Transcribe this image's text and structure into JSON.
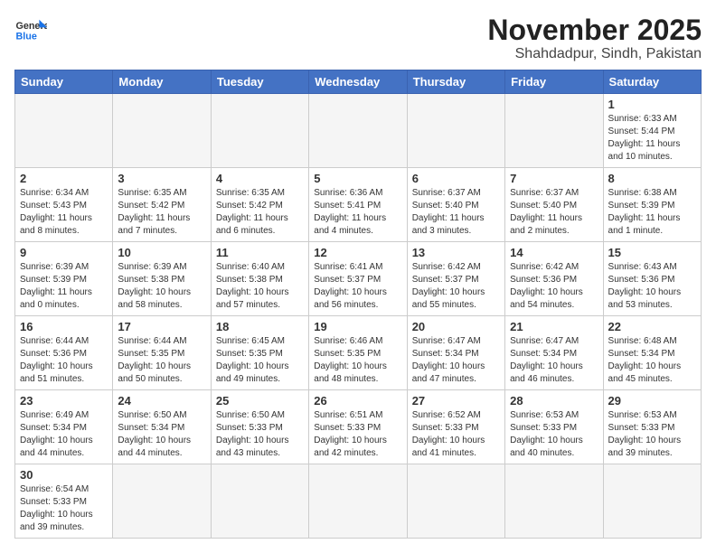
{
  "logo": {
    "text_general": "General",
    "text_blue": "Blue"
  },
  "title": "November 2025",
  "subtitle": "Shahdadpur, Sindh, Pakistan",
  "days_of_week": [
    "Sunday",
    "Monday",
    "Tuesday",
    "Wednesday",
    "Thursday",
    "Friday",
    "Saturday"
  ],
  "weeks": [
    [
      {
        "day": "",
        "info": ""
      },
      {
        "day": "",
        "info": ""
      },
      {
        "day": "",
        "info": ""
      },
      {
        "day": "",
        "info": ""
      },
      {
        "day": "",
        "info": ""
      },
      {
        "day": "",
        "info": ""
      },
      {
        "day": "1",
        "info": "Sunrise: 6:33 AM\nSunset: 5:44 PM\nDaylight: 11 hours and 10 minutes."
      }
    ],
    [
      {
        "day": "2",
        "info": "Sunrise: 6:34 AM\nSunset: 5:43 PM\nDaylight: 11 hours and 8 minutes."
      },
      {
        "day": "3",
        "info": "Sunrise: 6:35 AM\nSunset: 5:42 PM\nDaylight: 11 hours and 7 minutes."
      },
      {
        "day": "4",
        "info": "Sunrise: 6:35 AM\nSunset: 5:42 PM\nDaylight: 11 hours and 6 minutes."
      },
      {
        "day": "5",
        "info": "Sunrise: 6:36 AM\nSunset: 5:41 PM\nDaylight: 11 hours and 4 minutes."
      },
      {
        "day": "6",
        "info": "Sunrise: 6:37 AM\nSunset: 5:40 PM\nDaylight: 11 hours and 3 minutes."
      },
      {
        "day": "7",
        "info": "Sunrise: 6:37 AM\nSunset: 5:40 PM\nDaylight: 11 hours and 2 minutes."
      },
      {
        "day": "8",
        "info": "Sunrise: 6:38 AM\nSunset: 5:39 PM\nDaylight: 11 hours and 1 minute."
      }
    ],
    [
      {
        "day": "9",
        "info": "Sunrise: 6:39 AM\nSunset: 5:39 PM\nDaylight: 11 hours and 0 minutes."
      },
      {
        "day": "10",
        "info": "Sunrise: 6:39 AM\nSunset: 5:38 PM\nDaylight: 10 hours and 58 minutes."
      },
      {
        "day": "11",
        "info": "Sunrise: 6:40 AM\nSunset: 5:38 PM\nDaylight: 10 hours and 57 minutes."
      },
      {
        "day": "12",
        "info": "Sunrise: 6:41 AM\nSunset: 5:37 PM\nDaylight: 10 hours and 56 minutes."
      },
      {
        "day": "13",
        "info": "Sunrise: 6:42 AM\nSunset: 5:37 PM\nDaylight: 10 hours and 55 minutes."
      },
      {
        "day": "14",
        "info": "Sunrise: 6:42 AM\nSunset: 5:36 PM\nDaylight: 10 hours and 54 minutes."
      },
      {
        "day": "15",
        "info": "Sunrise: 6:43 AM\nSunset: 5:36 PM\nDaylight: 10 hours and 53 minutes."
      }
    ],
    [
      {
        "day": "16",
        "info": "Sunrise: 6:44 AM\nSunset: 5:36 PM\nDaylight: 10 hours and 51 minutes."
      },
      {
        "day": "17",
        "info": "Sunrise: 6:44 AM\nSunset: 5:35 PM\nDaylight: 10 hours and 50 minutes."
      },
      {
        "day": "18",
        "info": "Sunrise: 6:45 AM\nSunset: 5:35 PM\nDaylight: 10 hours and 49 minutes."
      },
      {
        "day": "19",
        "info": "Sunrise: 6:46 AM\nSunset: 5:35 PM\nDaylight: 10 hours and 48 minutes."
      },
      {
        "day": "20",
        "info": "Sunrise: 6:47 AM\nSunset: 5:34 PM\nDaylight: 10 hours and 47 minutes."
      },
      {
        "day": "21",
        "info": "Sunrise: 6:47 AM\nSunset: 5:34 PM\nDaylight: 10 hours and 46 minutes."
      },
      {
        "day": "22",
        "info": "Sunrise: 6:48 AM\nSunset: 5:34 PM\nDaylight: 10 hours and 45 minutes."
      }
    ],
    [
      {
        "day": "23",
        "info": "Sunrise: 6:49 AM\nSunset: 5:34 PM\nDaylight: 10 hours and 44 minutes."
      },
      {
        "day": "24",
        "info": "Sunrise: 6:50 AM\nSunset: 5:34 PM\nDaylight: 10 hours and 44 minutes."
      },
      {
        "day": "25",
        "info": "Sunrise: 6:50 AM\nSunset: 5:33 PM\nDaylight: 10 hours and 43 minutes."
      },
      {
        "day": "26",
        "info": "Sunrise: 6:51 AM\nSunset: 5:33 PM\nDaylight: 10 hours and 42 minutes."
      },
      {
        "day": "27",
        "info": "Sunrise: 6:52 AM\nSunset: 5:33 PM\nDaylight: 10 hours and 41 minutes."
      },
      {
        "day": "28",
        "info": "Sunrise: 6:53 AM\nSunset: 5:33 PM\nDaylight: 10 hours and 40 minutes."
      },
      {
        "day": "29",
        "info": "Sunrise: 6:53 AM\nSunset: 5:33 PM\nDaylight: 10 hours and 39 minutes."
      }
    ],
    [
      {
        "day": "30",
        "info": "Sunrise: 6:54 AM\nSunset: 5:33 PM\nDaylight: 10 hours and 39 minutes."
      },
      {
        "day": "",
        "info": ""
      },
      {
        "day": "",
        "info": ""
      },
      {
        "day": "",
        "info": ""
      },
      {
        "day": "",
        "info": ""
      },
      {
        "day": "",
        "info": ""
      },
      {
        "day": "",
        "info": ""
      }
    ]
  ]
}
